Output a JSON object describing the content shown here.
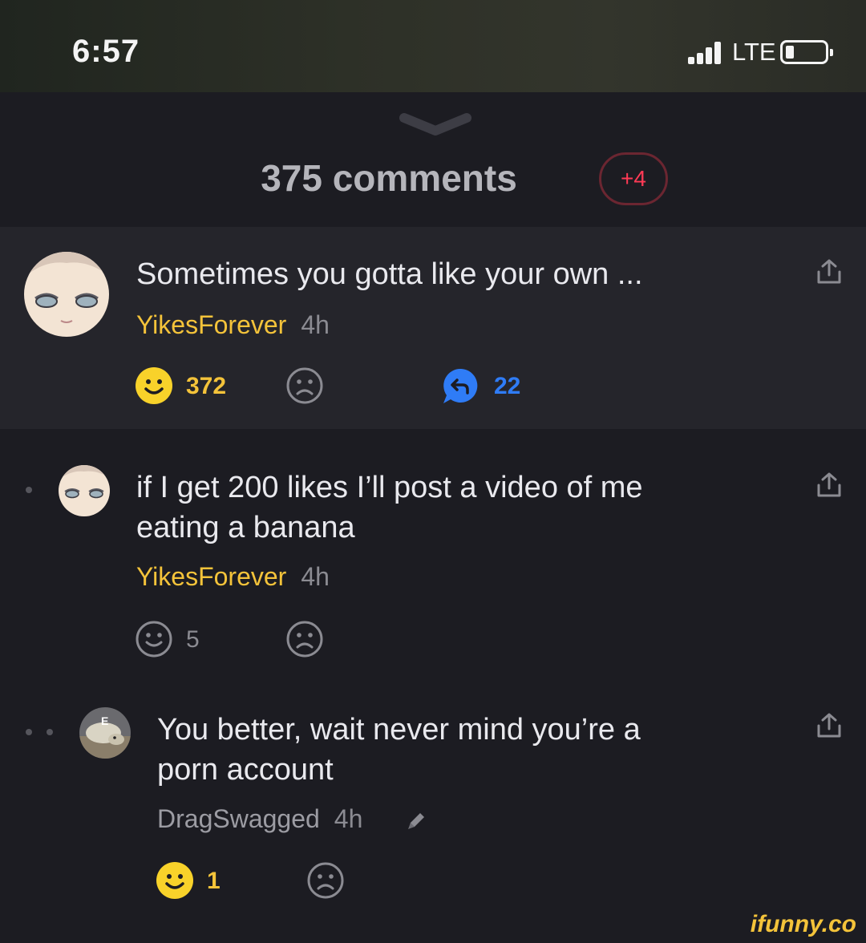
{
  "status_bar": {
    "time": "6:57",
    "network": "LTE"
  },
  "header": {
    "title": "375 comments",
    "new_badge": "+4"
  },
  "comments": [
    {
      "text": "Sometimes you gotta like your own ...",
      "author": "YikesForever",
      "time": "4h",
      "smile_count": "372",
      "reply_count": "22",
      "depth": 0
    },
    {
      "text_line1": "if I get 200 likes I’ll post a video of me",
      "text_line2": "eating a banana",
      "author": "YikesForever",
      "time": "4h",
      "smile_count": "5",
      "depth": 1
    },
    {
      "text_line1": "You better, wait never mind you’re a",
      "text_line2": "porn account",
      "author": "DragSwagged",
      "time": "4h",
      "smile_count": "1",
      "depth": 2
    }
  ],
  "colors": {
    "accent_yellow": "#f4c33a",
    "reply_blue": "#2f7cf6",
    "badge_red": "#ff3a55",
    "background": "#1c1c22"
  },
  "icons": [
    "share-icon",
    "smile-icon",
    "frown-icon",
    "reply-icon",
    "edit-pencil-icon",
    "chevron-down-icon"
  ],
  "watermark": "ifunny.co"
}
